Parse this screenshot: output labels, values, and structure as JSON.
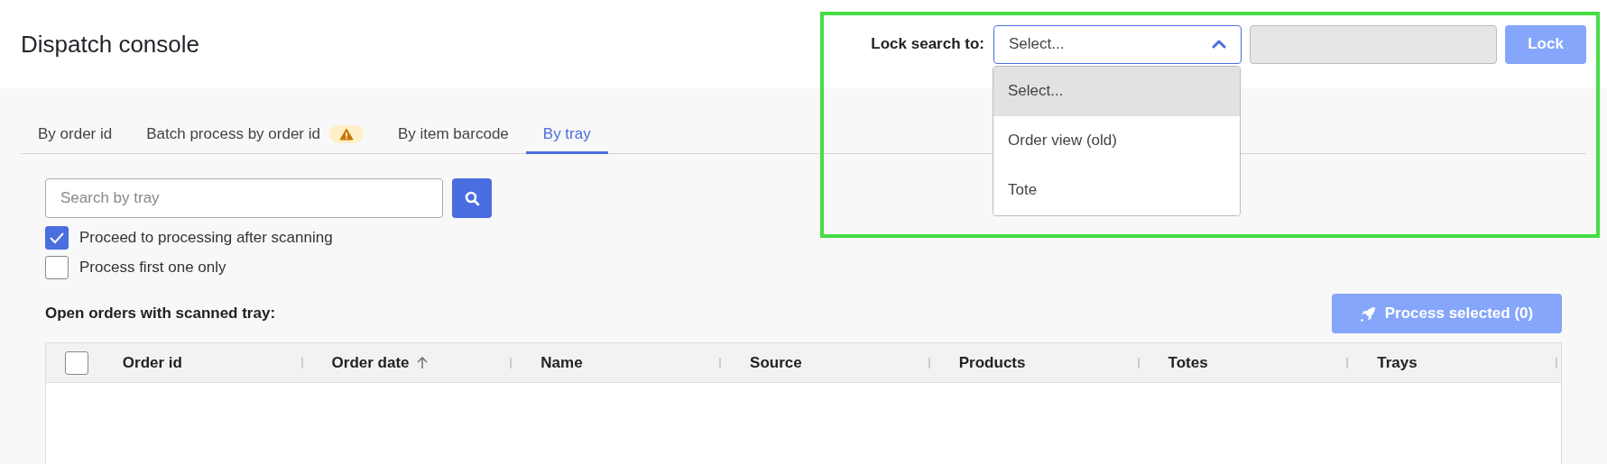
{
  "header": {
    "title": "Dispatch console",
    "lock_search": {
      "label": "Lock search to:",
      "select": {
        "value": "Select...",
        "expanded": true,
        "options": [
          {
            "label": "Select...",
            "selected": true
          },
          {
            "label": "Order view (old)",
            "selected": false
          },
          {
            "label": "Tote",
            "selected": false
          }
        ]
      },
      "input": {
        "disabled": true
      },
      "button": {
        "label": "Lock",
        "disabled": true
      }
    }
  },
  "tabs": [
    {
      "label": "By order id",
      "selected": false,
      "warning": false
    },
    {
      "label": "Batch process by order id",
      "selected": false,
      "warning": true
    },
    {
      "label": "By item barcode",
      "selected": false,
      "warning": false
    },
    {
      "label": "By tray",
      "selected": true,
      "warning": false
    }
  ],
  "search": {
    "placeholder": "Search by tray"
  },
  "options": [
    {
      "label": "Proceed to processing after scanning",
      "checked": true
    },
    {
      "label": "Process first one only",
      "checked": false
    }
  ],
  "orders": {
    "title": "Open orders with scanned tray:",
    "process_button": {
      "label": "Process selected (0)",
      "disabled": true
    },
    "select_all": {
      "checked": false
    },
    "columns": [
      {
        "label": "Order id",
        "sorted": false
      },
      {
        "label": "Order date",
        "sorted": true
      },
      {
        "label": "Name",
        "sorted": false
      },
      {
        "label": "Source",
        "sorted": false
      },
      {
        "label": "Products",
        "sorted": false
      },
      {
        "label": "Totes",
        "sorted": false
      },
      {
        "label": "Trays",
        "sorted": false
      }
    ]
  }
}
